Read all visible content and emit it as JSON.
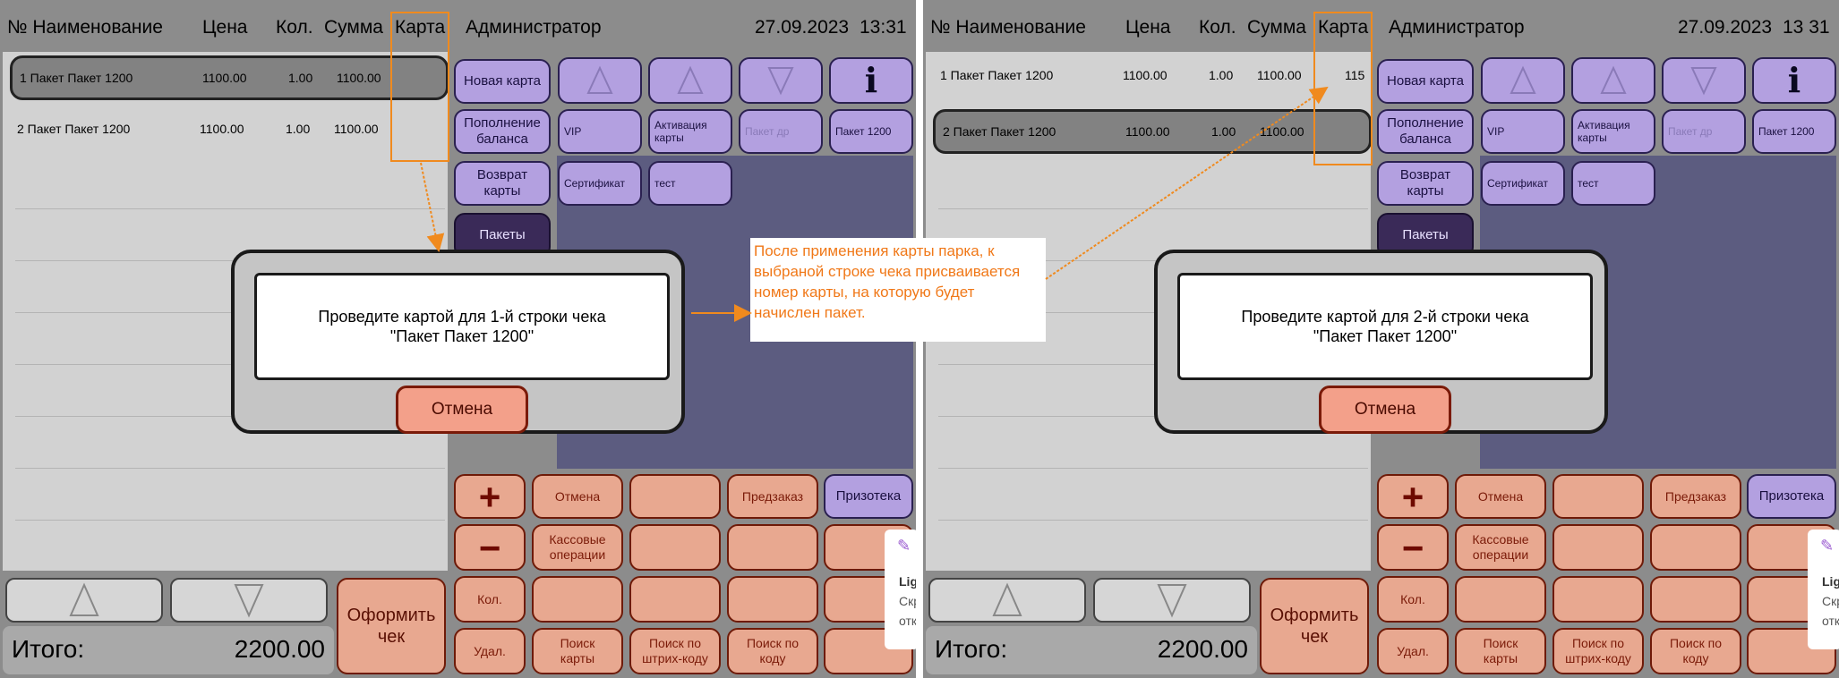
{
  "panels": [
    {
      "header": {
        "col_num_name": "№ Наименование",
        "col_price": "Цена",
        "col_qty": "Кол.",
        "col_sum": "Сумма",
        "col_card": "Карта",
        "user": "Администратор",
        "date": "27.09.2023",
        "time": "13:31"
      },
      "rows": [
        {
          "num_name": "1 Пакет Пакет 1200",
          "price": "1100.00",
          "qty": "1.00",
          "sum": "1100.00",
          "card": ""
        },
        {
          "num_name": "2 Пакет Пакет 1200",
          "price": "1100.00",
          "qty": "1.00",
          "sum": "1100.00",
          "card": ""
        }
      ],
      "selected_row": 0,
      "total_label": "Итого:",
      "total_value": "2200.00",
      "checkout_label": "Оформить\nчек",
      "dialog": {
        "message": "Проведите картой для 1-й строки чека\n\"Пакет Пакет 1200\"",
        "cancel": "Отмена"
      }
    },
    {
      "header": {
        "col_num_name": "№ Наименование",
        "col_price": "Цена",
        "col_qty": "Кол.",
        "col_sum": "Сумма",
        "col_card": "Карта",
        "user": "Администратор",
        "date": "27.09.2023",
        "time": "13 31"
      },
      "rows": [
        {
          "num_name": "1 Пакет Пакет 1200",
          "price": "1100.00",
          "qty": "1.00",
          "sum": "1100.00",
          "card": "115"
        },
        {
          "num_name": "2 Пакет Пакет 1200",
          "price": "1100.00",
          "qty": "1.00",
          "sum": "1100.00",
          "card": ""
        }
      ],
      "selected_row": 1,
      "total_label": "Итого:",
      "total_value": "2200.00",
      "checkout_label": "Оформить\nчек",
      "dialog": {
        "message": "Проведите картой для 2-й строки чека\n\"Пакет Пакет 1200\"",
        "cancel": "Отмена"
      }
    }
  ],
  "purple_buttons": {
    "new_card": "Новая карта",
    "topup": "Пополнение\nбаланса",
    "return_card": "Возврат\nкарты",
    "packages": "Пакеты",
    "vip": "VIP",
    "activate": "Активация\nкарты",
    "hidden": "Пакет др",
    "package_1200": "Пакет 1200",
    "certificate": "Сертификат",
    "test": "тест",
    "info_icon": "i"
  },
  "red_buttons": {
    "plus": "+",
    "minus": "−",
    "cancel": "Отмена",
    "preorder": "Предзаказ",
    "prizoteka": "Призотека",
    "cash_ops": "Кассовые\nоперации",
    "qty": "Кол.",
    "delete": "Удал.",
    "search_card": "Поиск\nкарты",
    "search_barcode": "Поиск по\nштрих-коду",
    "search_code": "Поиск по\nкоду"
  },
  "side_popup": {
    "title": "Lig",
    "line1": "Скр",
    "line2": "отк"
  },
  "annotation": "После применения карты парка, к выбраной строке чека присваивается номер карты, на которую будет начислен пакет.",
  "colors": {
    "accent": "#f08a1e",
    "purple": "#b3a0e0",
    "red": "#e8a890",
    "dark_purple": "#3a2a58"
  }
}
